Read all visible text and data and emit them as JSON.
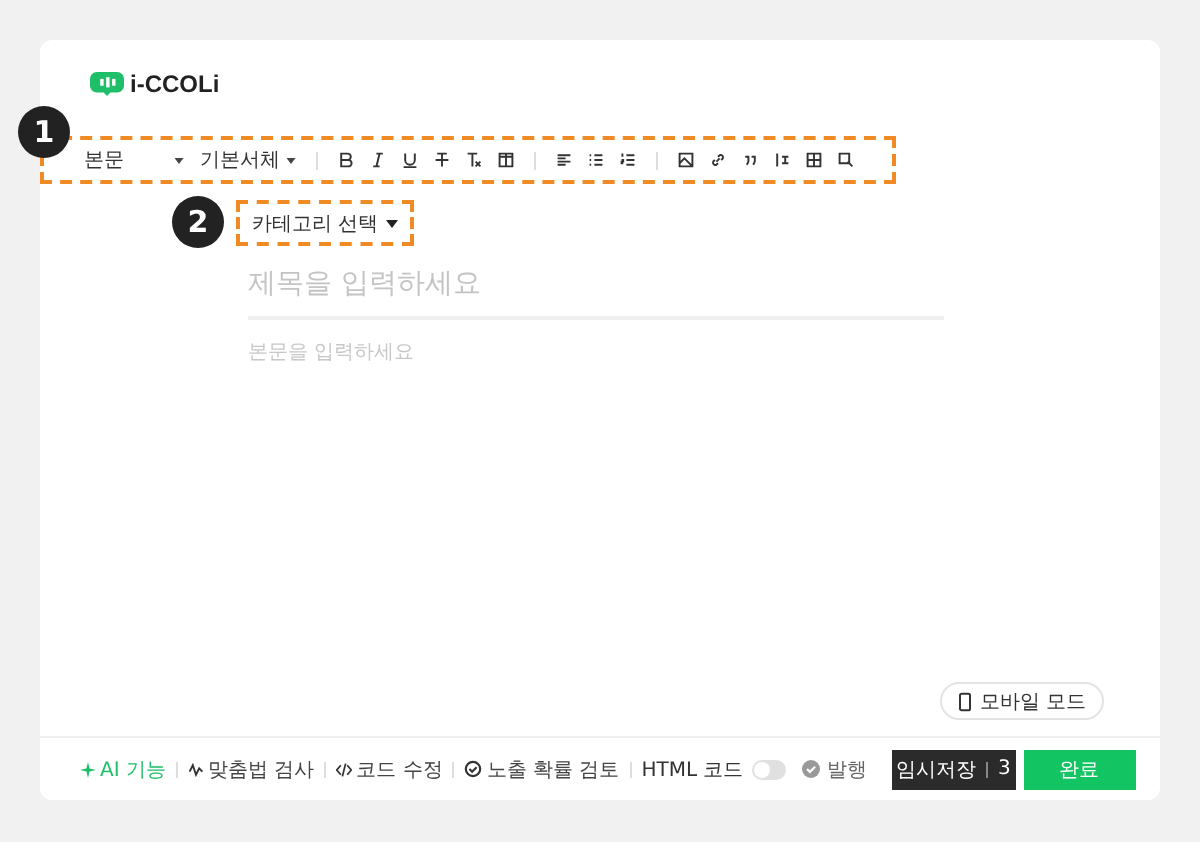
{
  "logo": {
    "text": "i-CCOLi"
  },
  "annotations": [
    {
      "number": "1"
    },
    {
      "number": "2"
    }
  ],
  "toolbar": {
    "dropdowns": [
      {
        "label": "본문"
      },
      {
        "label": "기본서체"
      }
    ]
  },
  "category": {
    "label": "카테고리 선택"
  },
  "editor": {
    "title_placeholder": "제목을 입력하세요",
    "body_placeholder": "본문을 입력하세요"
  },
  "mobile_button": {
    "label": "모바일 모드"
  },
  "footer": {
    "tools": [
      {
        "kind": "ai",
        "label": "AI 기능"
      },
      {
        "kind": "spell",
        "label": "맞춤법 검사"
      },
      {
        "kind": "code",
        "label": "코드 수정"
      },
      {
        "kind": "review",
        "label": "노출 확률 검토"
      }
    ],
    "html_toggle": {
      "label": "HTML 코드",
      "on": false
    },
    "publish_check": {
      "label": "발행"
    },
    "save_button": {
      "label": "임시저장",
      "count": "3"
    },
    "done_button": {
      "label": "완료"
    }
  }
}
